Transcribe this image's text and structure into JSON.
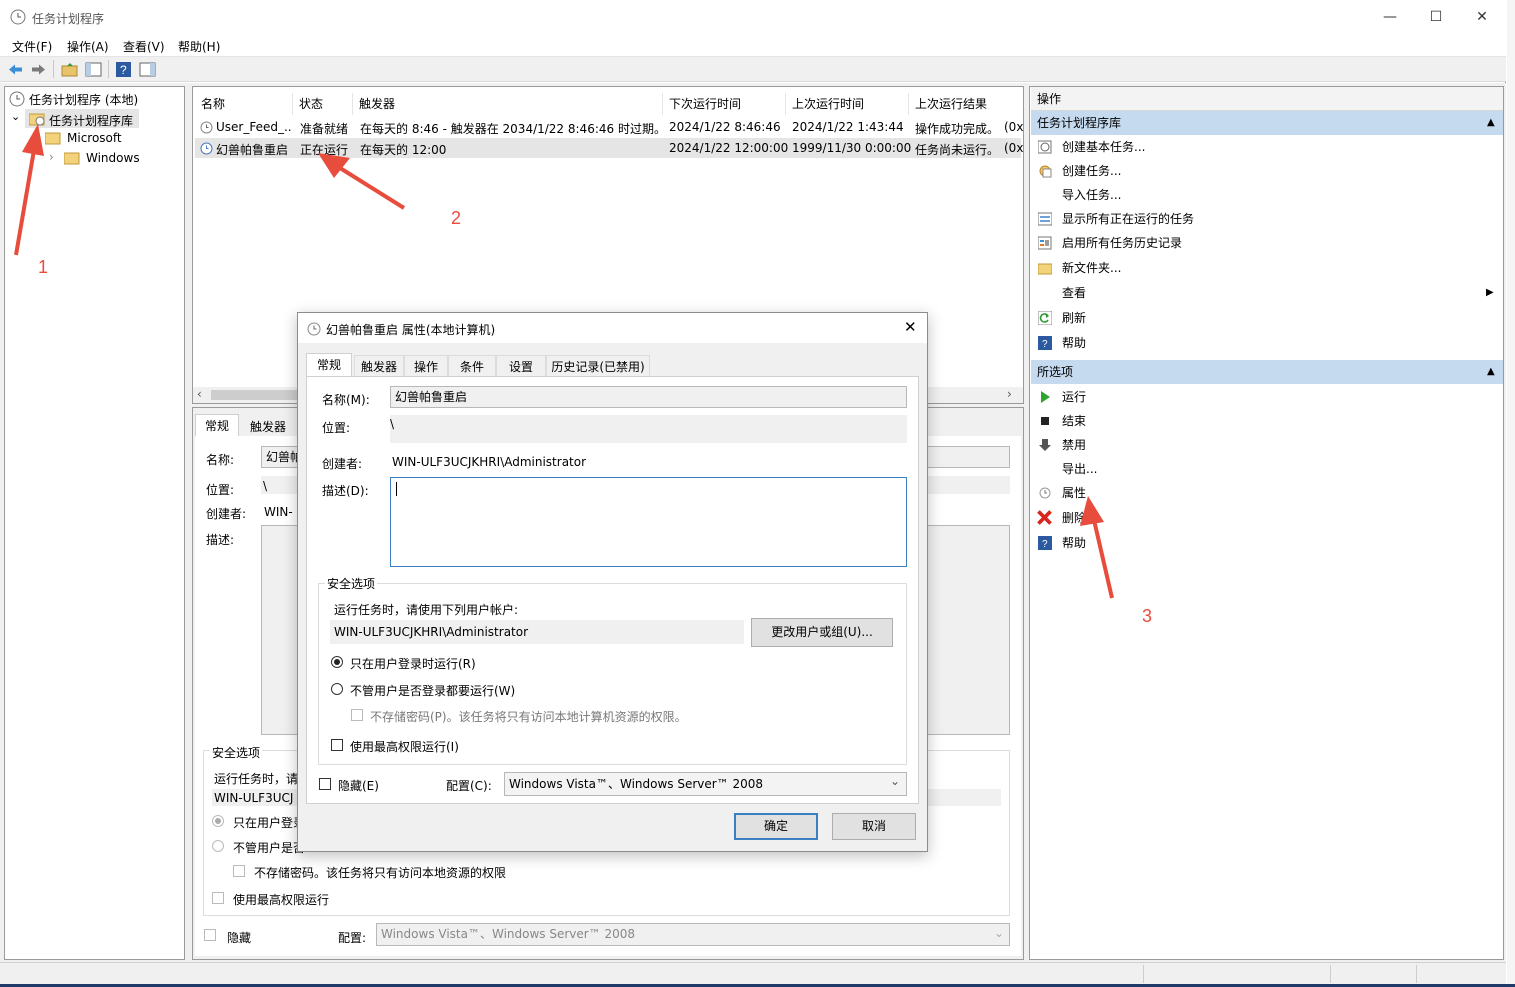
{
  "window": {
    "title": "任务计划程序",
    "buttons": {
      "minimize": "—",
      "maximize": "☐",
      "close": "✕"
    }
  },
  "menu": [
    "文件(F)",
    "操作(A)",
    "查看(V)",
    "帮助(H)"
  ],
  "tree": {
    "root": "任务计划程序 (本地)",
    "library": "任务计划程序库",
    "microsoft": "Microsoft",
    "windows": "Windows"
  },
  "task_list": {
    "columns": [
      "名称",
      "状态",
      "触发器",
      "下次运行时间",
      "上次运行时间",
      "上次运行结果"
    ],
    "rows": [
      {
        "name": "User_Feed_...",
        "status": "准备就绪",
        "trigger": "在每天的 8:46 - 触发器在 2034/1/22 8:46:46 时过期。",
        "next": "2024/1/22 8:46:46",
        "last": "2024/1/22 1:43:44",
        "result": "操作成功完成。",
        "extra": "(0x"
      },
      {
        "name": "幻兽帕鲁重启",
        "status": "正在运行",
        "trigger": "在每天的 12:00",
        "next": "2024/1/22 12:00:00",
        "last": "1999/11/30 0:00:00",
        "result": "任务尚未运行。",
        "extra": "(0x"
      }
    ]
  },
  "detail": {
    "tabs": [
      "常规",
      "触发器"
    ],
    "name_label": "名称:",
    "name_value": "幻兽帕",
    "location_label": "位置:",
    "location_value": "\\",
    "author_label": "创建者:",
    "author_value": "WIN-",
    "desc_label": "描述:",
    "security_title": "安全选项",
    "run_as_text": "运行任务时，请",
    "account": "WIN-ULF3UCJ",
    "radio1": "只在用户登录",
    "radio2": "不管用户是否",
    "nostore": "不存储密码。该任务将只有访问本地资源的权限",
    "highest": "使用最高权限运行",
    "hidden": "隐藏",
    "config_label": "配置:",
    "config_value": "Windows Vista™、Windows Server™ 2008"
  },
  "actions": {
    "header": "操作",
    "section1": "任务计划程序库",
    "items1": [
      "创建基本任务...",
      "创建任务...",
      "导入任务...",
      "显示所有正在运行的任务",
      "启用所有任务历史记录",
      "新文件夹...",
      "查看",
      "刷新",
      "帮助"
    ],
    "section2": "所选项",
    "items2": [
      "运行",
      "结束",
      "禁用",
      "导出...",
      "属性",
      "删除",
      "帮助"
    ]
  },
  "dialog": {
    "title": "幻兽帕鲁重启 属性(本地计算机)",
    "tabs": [
      "常规",
      "触发器",
      "操作",
      "条件",
      "设置",
      "历史记录(已禁用)"
    ],
    "name_label": "名称(M):",
    "name_value": "幻兽帕鲁重启",
    "location_label": "位置:",
    "location_value": "\\",
    "author_label": "创建者:",
    "author_value": "WIN-ULF3UCJKHRI\\Administrator",
    "desc_label": "描述(D):",
    "security_title": "安全选项",
    "run_as_text": "运行任务时，请使用下列用户帐户:",
    "account": "WIN-ULF3UCJKHRI\\Administrator",
    "change_user": "更改用户或组(U)...",
    "radio1": "只在用户登录时运行(R)",
    "radio2": "不管用户是否登录都要运行(W)",
    "nostore": "不存储密码(P)。该任务将只有访问本地计算机资源的权限。",
    "highest": "使用最高权限运行(I)",
    "hidden": "隐藏(E)",
    "config_label": "配置(C):",
    "config_value": "Windows Vista™、Windows Server™ 2008",
    "ok": "确定",
    "cancel": "取消"
  },
  "annotations": [
    "1",
    "2",
    "3"
  ],
  "colors": {
    "accent": "#cce4f7",
    "header_blue": "#c5d9ef",
    "arrow_red": "#e74c3c",
    "selection": "#e5e5e5"
  }
}
